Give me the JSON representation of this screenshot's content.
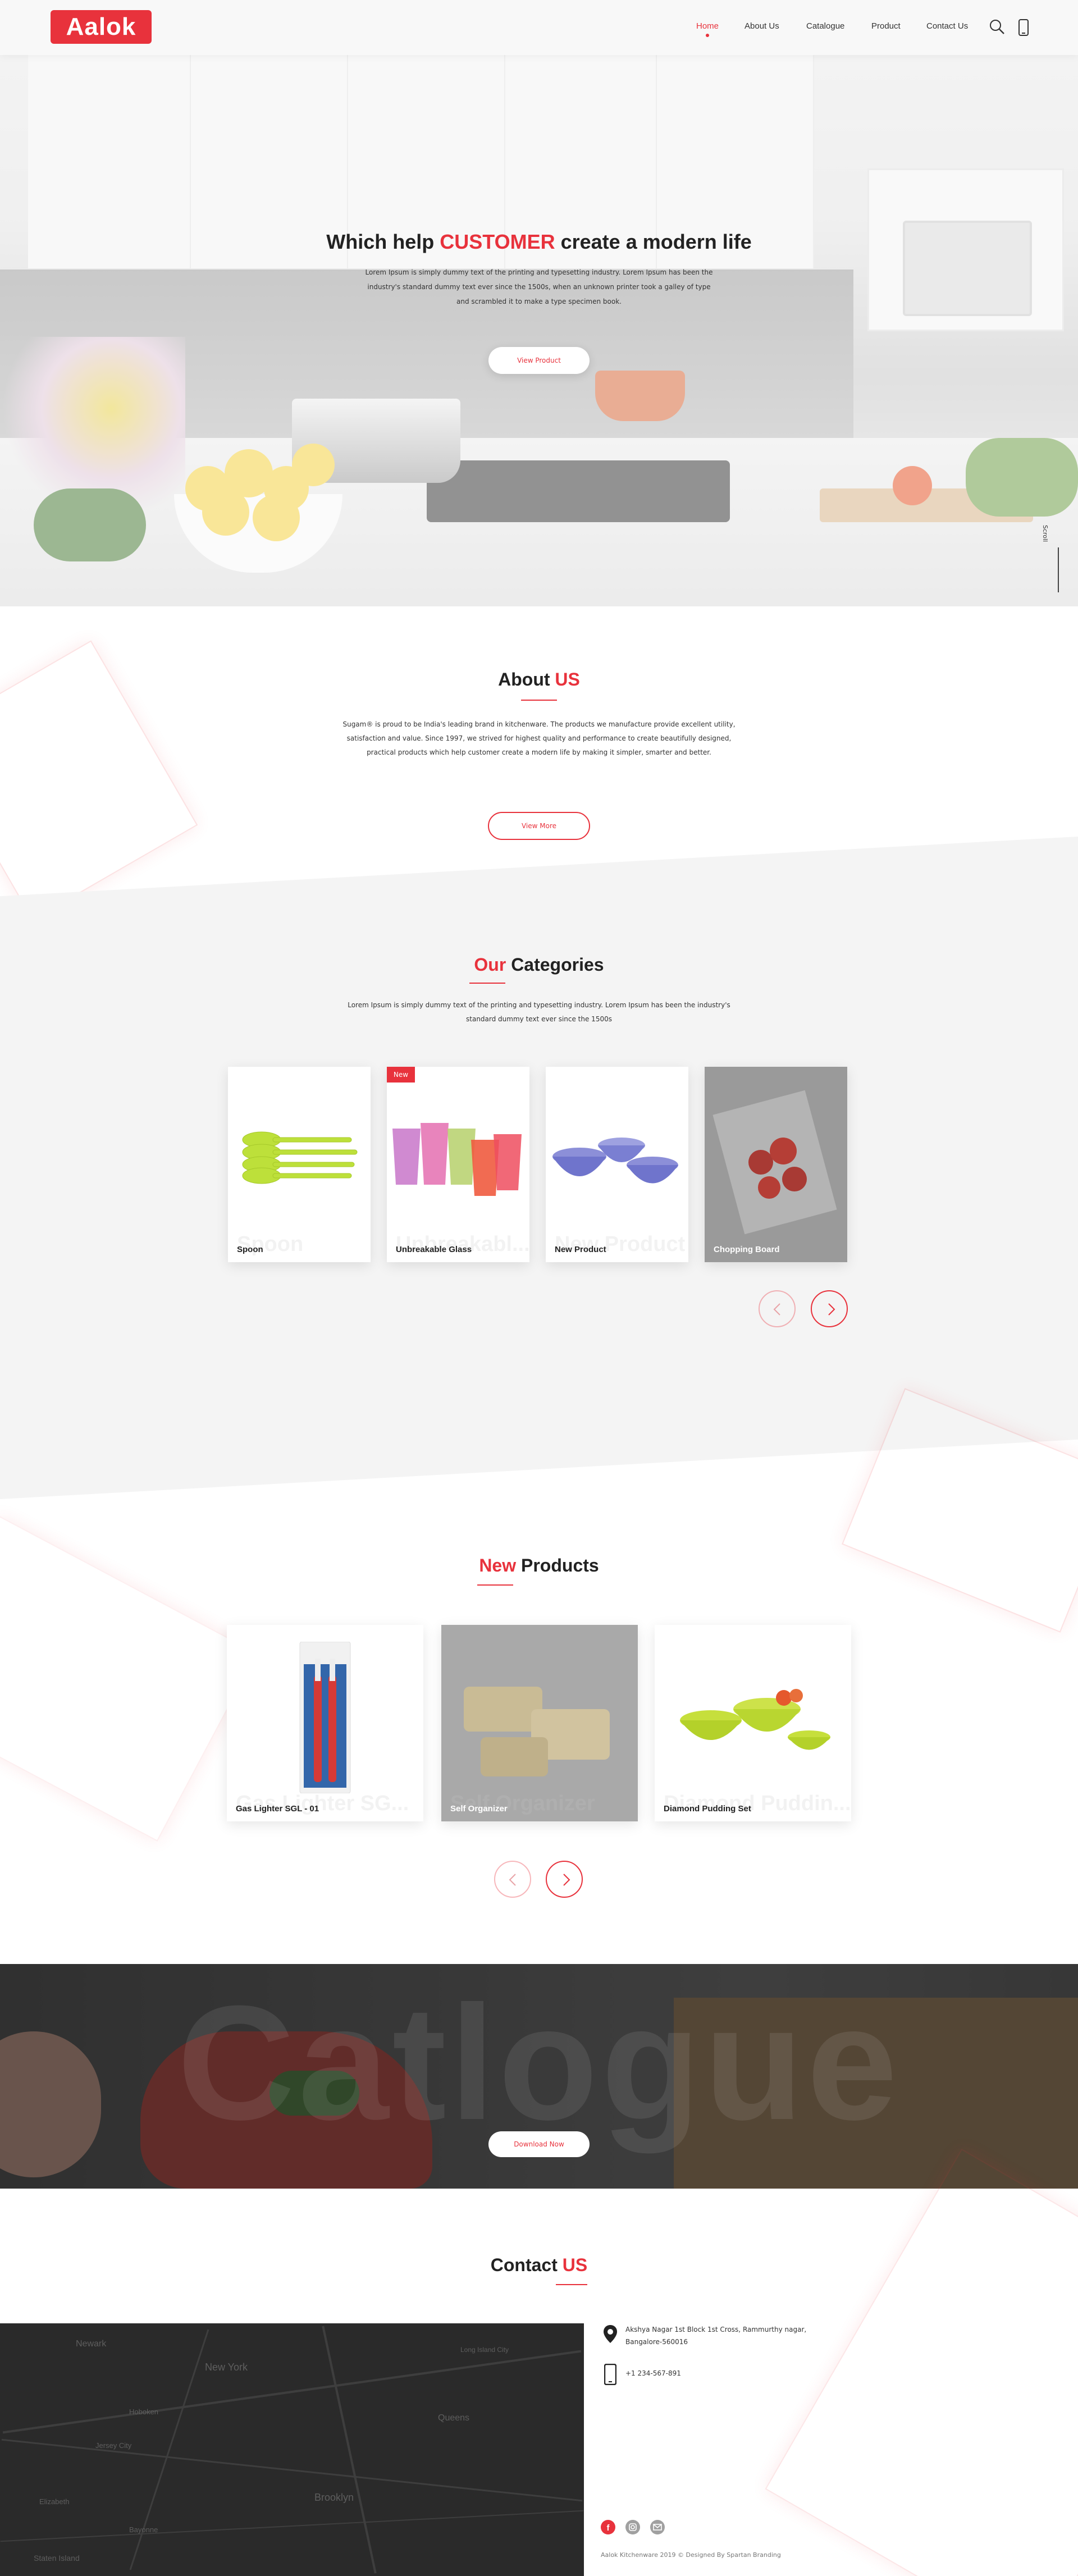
{
  "brand": {
    "logo_text": "Aalok",
    "accent": "#e8323c"
  },
  "nav": {
    "items": [
      {
        "label": "Home",
        "active": true
      },
      {
        "label": "About Us",
        "active": false
      },
      {
        "label": "Catalogue",
        "active": false
      },
      {
        "label": "Product",
        "active": false
      },
      {
        "label": "Contact Us",
        "active": false
      }
    ],
    "icons": [
      "search-icon",
      "phone-icon"
    ]
  },
  "hero": {
    "title_before": "Which help ",
    "title_highlight": "CUSTOMER",
    "title_after": " create a modern life",
    "text": "Lorem Ipsum is simply dummy text of the printing and typesetting industry. Lorem Ipsum has been the industry's standard dummy text ever since the 1500s, when an unknown printer took a galley of type and scrambled it to make a type specimen book.",
    "button": "View Product",
    "scroll_label": "Scroll"
  },
  "about": {
    "title_plain": "About ",
    "title_red": "US",
    "text": "Sugam® is proud to be India's leading brand in kitchenware. The products we manufacture provide excellent utility, satisfaction and value. Since 1997, we strived for highest quality and performance to create beautifully designed, practical products which help customer create a modern life by making it simpler, smarter and better.",
    "button": "View More"
  },
  "categories": {
    "title_red": "Our",
    "title_plain": " Categories",
    "text": "Lorem Ipsum is simply dummy text of the printing and typesetting industry. Lorem Ipsum has been the industry's standard dummy text ever since the 1500s",
    "items": [
      {
        "label": "Spoon",
        "ghost": "Spoon",
        "badge": ""
      },
      {
        "label": "Unbreakable Glass",
        "ghost": "Unbreakabl...",
        "badge": "New"
      },
      {
        "label": "New Product",
        "ghost": "New Product",
        "badge": ""
      },
      {
        "label": "Chopping Board",
        "ghost": "",
        "badge": ""
      }
    ],
    "prev_icon": "chevron-left-icon",
    "next_icon": "chevron-right-icon"
  },
  "new_products": {
    "title_red": "New",
    "title_plain": " Products",
    "items": [
      {
        "label": "Gas Lighter SGL - 01",
        "ghost": "Gas Lighter SG..."
      },
      {
        "label": "Self Organizer",
        "ghost": "Self Organizer"
      },
      {
        "label": "Diamond Pudding Set",
        "ghost": "Diamond Puddin..."
      }
    ]
  },
  "catalogue": {
    "big_text": "Catlogue",
    "button": "Download Now"
  },
  "contact": {
    "title_plain": "Contact ",
    "title_red": "US",
    "address": "Akshya Nagar 1st Block 1st Cross, Rammurthy nagar, Bangalore-560016",
    "phone": "+1 234-567-891",
    "map_labels": [
      "Newark",
      "New York",
      "Hoboken",
      "Queens",
      "Brooklyn",
      "Jersey City",
      "Staten Island",
      "Long Island City",
      "Elizabeth",
      "Bayonne"
    ],
    "social_icons": [
      "facebook-icon",
      "instagram-icon",
      "email-icon"
    ],
    "footer": "Aalok Kitchenware 2019 © Designed By Spartan Branding"
  }
}
